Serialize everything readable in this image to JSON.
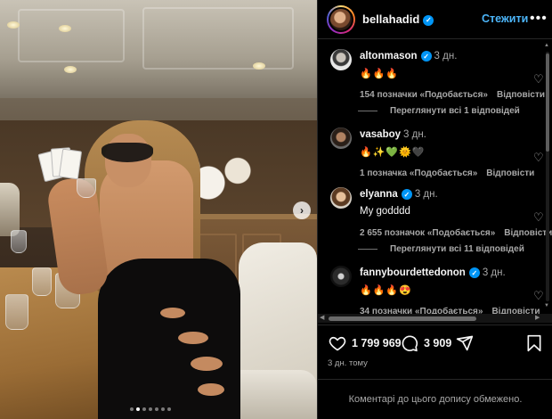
{
  "post": {
    "username": "bellahadid",
    "follow_label": "Стежити",
    "more_label": "•••",
    "likes": "1 799 969",
    "comments_count": "3 909",
    "timestamp": "3 дн. тому",
    "comments_limited": "Коментарі до цього допису обмежено.",
    "carousel_index": 2,
    "carousel_total": 7
  },
  "comments": [
    {
      "username": "altonmason",
      "verified": true,
      "time": "3 дн.",
      "text": "🔥🔥🔥",
      "likes": "154 позначки «Подобається»",
      "reply": "Відповісти",
      "view_replies": "Переглянути всі 1 відповідей"
    },
    {
      "username": "vasaboy",
      "verified": false,
      "time": "3 дн.",
      "text": "🔥✨💚🌞🖤",
      "likes": "1 позначка «Подобається»",
      "reply": "Відповісти"
    },
    {
      "username": "elyanna",
      "verified": true,
      "time": "3 дн.",
      "text": "My godddd",
      "likes": "2 655 позначок «Подобається»",
      "reply": "Відповісти",
      "view_replies": "Переглянути всі 11 відповідей"
    },
    {
      "username": "fannybourdettedonon",
      "verified": true,
      "time": "3 дн.",
      "text": "🔥🔥🔥😍",
      "likes": "34 позначки «Подобається»",
      "reply": "Відповісти"
    }
  ],
  "colors": {
    "background": "#000000",
    "accent": "#4cb5f9",
    "verified": "#0095f6",
    "muted": "#a8a8a8"
  },
  "icons": [
    "verified-badge-icon",
    "heart-icon",
    "comment-icon",
    "share-icon",
    "bookmark-icon",
    "chevron-right-icon",
    "more-icon"
  ]
}
